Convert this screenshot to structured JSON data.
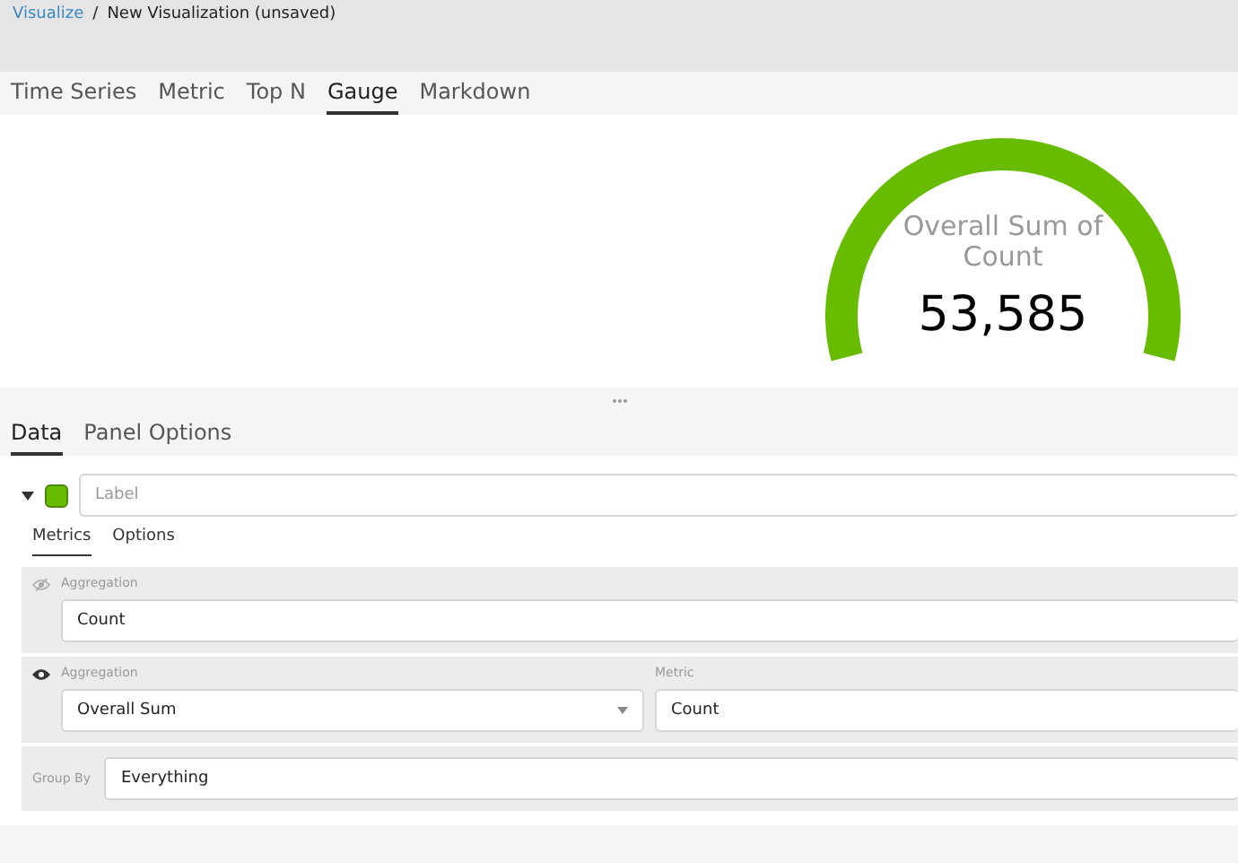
{
  "breadcrumb": {
    "link": "Visualize",
    "separator": "/",
    "current": "New Visualization (unsaved)"
  },
  "viz_tabs": [
    {
      "label": "Time Series",
      "selected": false
    },
    {
      "label": "Metric",
      "selected": false
    },
    {
      "label": "Top N",
      "selected": false
    },
    {
      "label": "Gauge",
      "selected": true
    },
    {
      "label": "Markdown",
      "selected": false
    }
  ],
  "gauge": {
    "label": "Overall Sum of Count",
    "value": "53,585"
  },
  "editor_tabs": [
    {
      "label": "Data",
      "selected": true
    },
    {
      "label": "Panel Options",
      "selected": false
    }
  ],
  "series": {
    "expanded": true,
    "color": "#68bc00",
    "label_placeholder": "Label",
    "tabs": [
      {
        "label": "Metrics",
        "selected": true
      },
      {
        "label": "Options",
        "selected": false
      }
    ],
    "metrics": [
      {
        "visible": false,
        "fields": [
          {
            "label": "Aggregation",
            "value": "Count",
            "kind": "text"
          }
        ]
      },
      {
        "visible": true,
        "fields": [
          {
            "label": "Aggregation",
            "value": "Overall Sum",
            "kind": "select"
          },
          {
            "label": "Metric",
            "value": "Count",
            "kind": "text"
          }
        ]
      }
    ],
    "group_by": {
      "label": "Group By",
      "value": "Everything"
    }
  }
}
